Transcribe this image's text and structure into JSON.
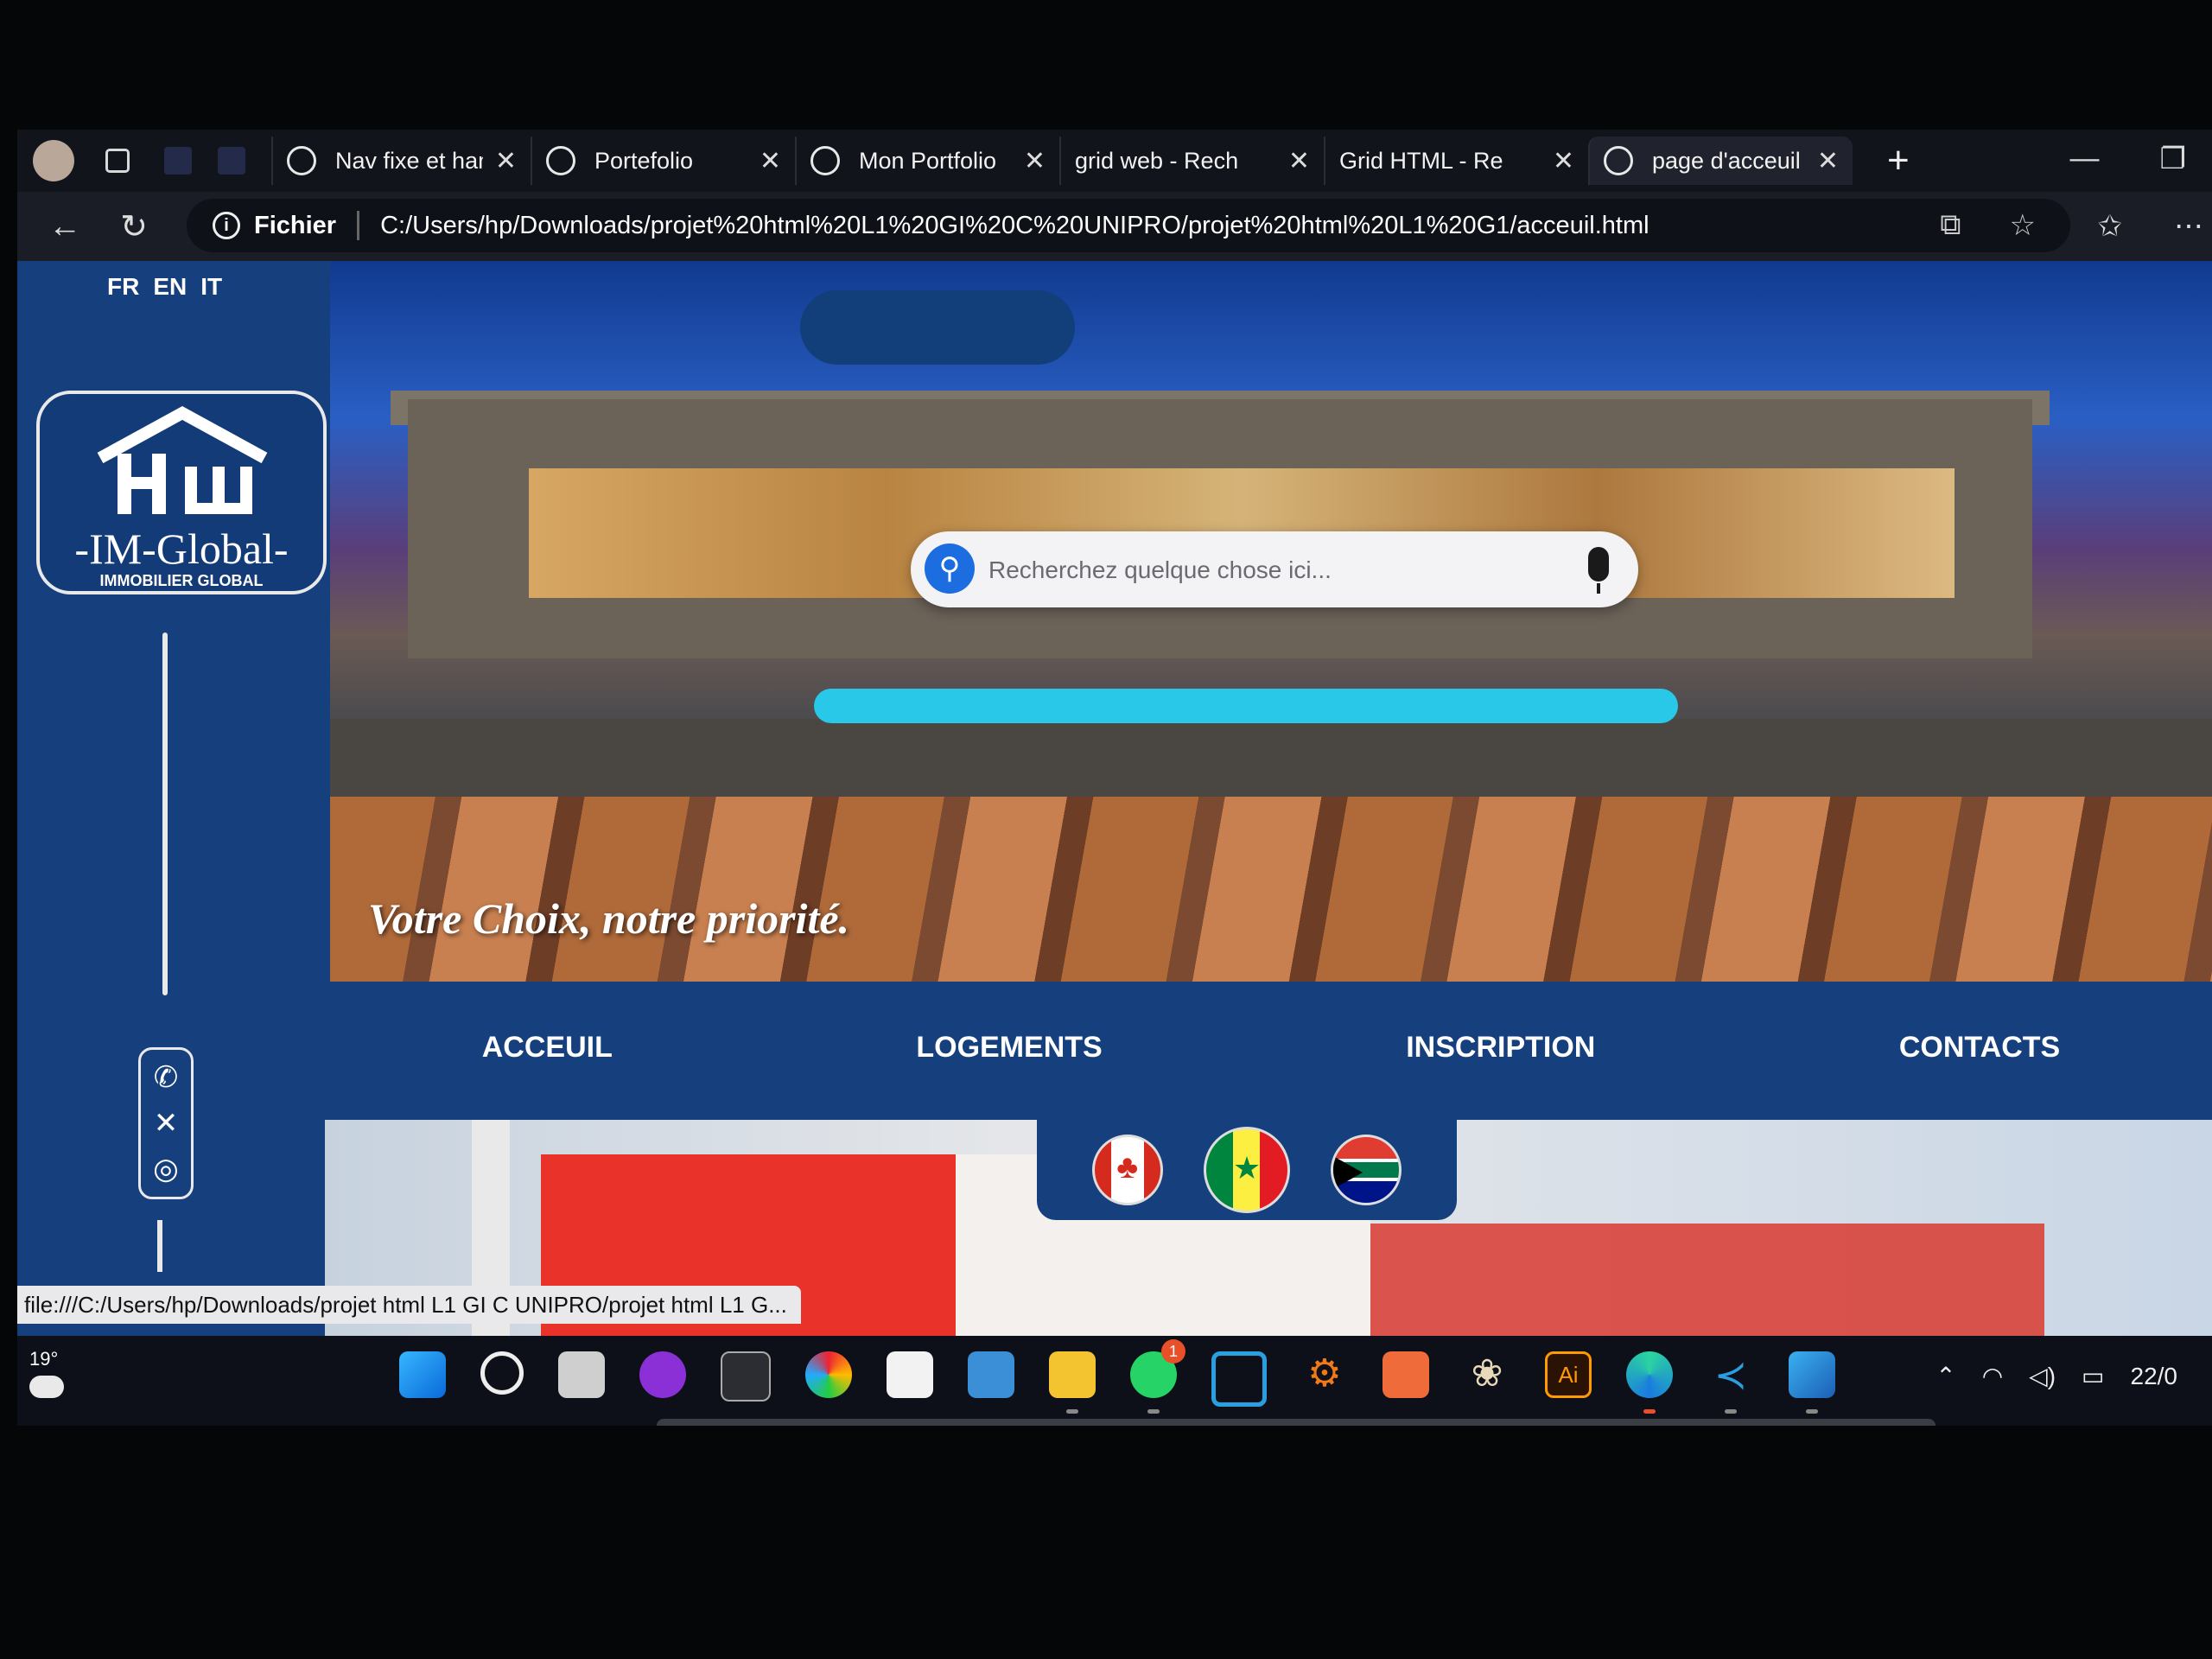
{
  "browser": {
    "tabs": [
      {
        "label": "Nav fixe et ham",
        "icon": "ai-chat-icon"
      },
      {
        "label": "Portefolio",
        "icon": "globe-icon"
      },
      {
        "label": "Mon Portfolio",
        "icon": "globe-icon"
      },
      {
        "label": "grid web - Rech",
        "icon": "search-icon"
      },
      {
        "label": "Grid HTML - Re",
        "icon": "search-icon"
      },
      {
        "label": "page d'acceuil",
        "icon": "globe-icon",
        "active": true
      }
    ],
    "close_glyph": "✕",
    "new_tab_glyph": "+",
    "back_glyph": "←",
    "reload_glyph": "↻",
    "address": {
      "scheme_label": "Fichier",
      "url": "C:/Users/hp/Downloads/projet%20html%20L1%20GI%20C%20UNIPRO/projet%20html%20L1%20G1/acceuil.html"
    },
    "status_link": "file:///C:/Users/hp/Downloads/projet html L1 GI C UNIPRO/projet html L1 G..."
  },
  "site": {
    "languages": [
      "FR",
      "EN",
      "IT"
    ],
    "logo": {
      "brand": "-IM-Global-",
      "subtitle": "IMMOBILIER GLOBAL"
    },
    "search": {
      "placeholder": "Recherchez quelque chose ici..."
    },
    "tagline": "Votre Choix, notre priorité.",
    "nav": [
      "ACCEUIL",
      "LOGEMENTS",
      "INSCRIPTION",
      "CONTACTS"
    ],
    "flags": [
      "canada-flag",
      "senegal-flag",
      "south-africa-flag"
    ]
  },
  "taskbar": {
    "weather_temp": "19°",
    "whatsapp_badge": "1",
    "clock": "22/0"
  },
  "colors": {
    "site_blue": "#163f7d",
    "search_accent": "#1c6ee0"
  }
}
